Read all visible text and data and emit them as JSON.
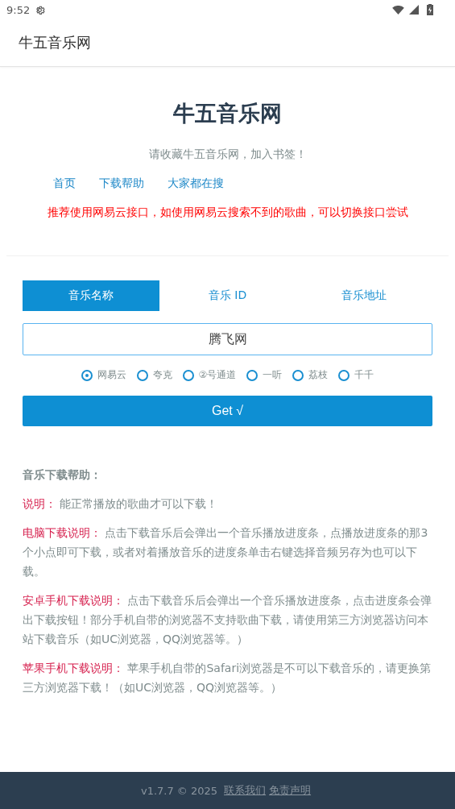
{
  "status_bar": {
    "time": "9:52"
  },
  "app_bar": {
    "title": "牛五音乐网"
  },
  "header": {
    "title": "牛五音乐网",
    "subtitle": "请收藏牛五音乐网，加入书签！",
    "links": [
      "首页",
      "下载帮助",
      "大家都在搜"
    ],
    "notice": "推荐使用网易云接口，如使用网易云搜索不到的歌曲，可以切换接口尝试"
  },
  "tabs": [
    {
      "label": "音乐名称",
      "selected": true
    },
    {
      "label": "音乐 ID",
      "selected": false
    },
    {
      "label": "音乐地址",
      "selected": false
    }
  ],
  "search": {
    "value": "腾飞网"
  },
  "sources": [
    {
      "label": "网易云",
      "selected": true
    },
    {
      "label": "夸克",
      "selected": false
    },
    {
      "label": "②号通道",
      "selected": false
    },
    {
      "label": "一听",
      "selected": false
    },
    {
      "label": "荔枝",
      "selected": false
    },
    {
      "label": "千千",
      "selected": false
    }
  ],
  "submit": "Get √",
  "help": {
    "title": "音乐下载帮助：",
    "items": [
      {
        "label": "说明：",
        "text": "能正常播放的歌曲才可以下载！"
      },
      {
        "label": "电脑下载说明：",
        "text": "点击下载音乐后会弹出一个音乐播放进度条，点播放进度条的那3个小点即可下载，或者对着播放音乐的进度条单击右键选择音频另存为也可以下载。"
      },
      {
        "label": "安卓手机下载说明：",
        "text": "点击下载音乐后会弹出一个音乐播放进度条，点击进度条会弹出下载按钮！部分手机自带的浏览器不支持歌曲下载，请使用第三方浏览器访问本站下载音乐（如UC浏览器，QQ浏览器等。）"
      },
      {
        "label": "苹果手机下载说明：",
        "text": "苹果手机自带的Safari浏览器是不可以下载音乐的，请更换第三方浏览器下载！（如UC浏览器，QQ浏览器等。）"
      }
    ]
  },
  "footer": {
    "version": "v1.7.7 © 2025",
    "links": [
      "联系我们",
      "免责声明"
    ]
  }
}
